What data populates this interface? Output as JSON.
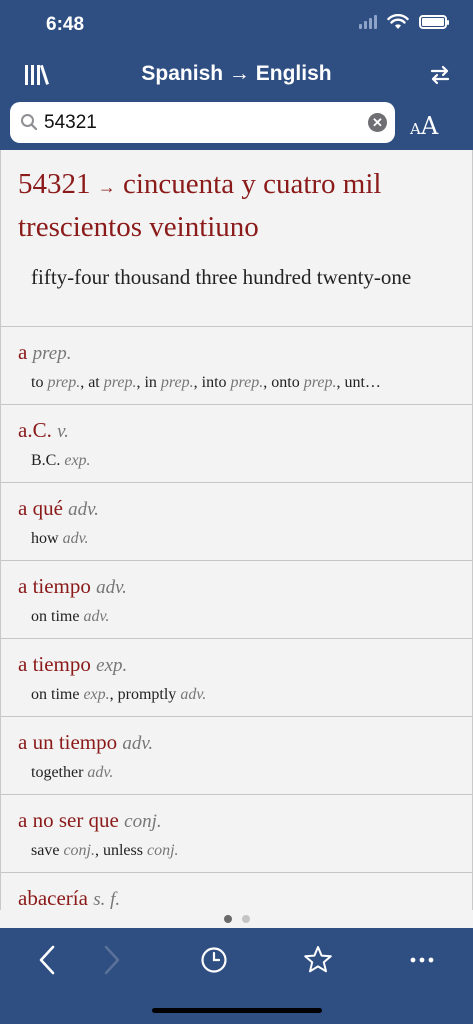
{
  "status_bar": {
    "time": "6:48"
  },
  "nav": {
    "title": "Spanish → English"
  },
  "search": {
    "value": "54321",
    "placeholder": ""
  },
  "font_button": {
    "small": "A",
    "big": "A"
  },
  "main_entry": {
    "headword": "54321",
    "arrow": "→",
    "result": "cincuenta y cuatro mil trescientos veintiuno",
    "translation": "fifty-four thousand three hundred twenty-one"
  },
  "entries": [
    {
      "head": "a",
      "pos": "prep.",
      "translation": "to prep., at prep., in prep., into prep., onto prep., unt…"
    },
    {
      "head": "a.C.",
      "pos": "v.",
      "translation": "B.C. exp."
    },
    {
      "head": "a qué",
      "pos": "adv.",
      "translation": "how adv."
    },
    {
      "head": "a tiempo",
      "pos": "adv.",
      "translation": "on time adv."
    },
    {
      "head": "a tiempo",
      "pos": "exp.",
      "translation": "on time exp., promptly adv."
    },
    {
      "head": "a un tiempo",
      "pos": "adv.",
      "translation": "together adv."
    },
    {
      "head": "a no ser que",
      "pos": "conj.",
      "translation": "save conj., unless conj."
    },
    {
      "head": "abacería",
      "pos": "s. f.",
      "translation": ""
    }
  ],
  "toolbar": {
    "back": "chevron-left-icon",
    "forward": "chevron-right-icon",
    "history": "clock-icon",
    "favorites": "star-icon",
    "more": "ellipsis-icon"
  },
  "colors": {
    "bar": "#2f4f83",
    "headword": "#8b1a1a",
    "background": "#f3f3f3"
  }
}
